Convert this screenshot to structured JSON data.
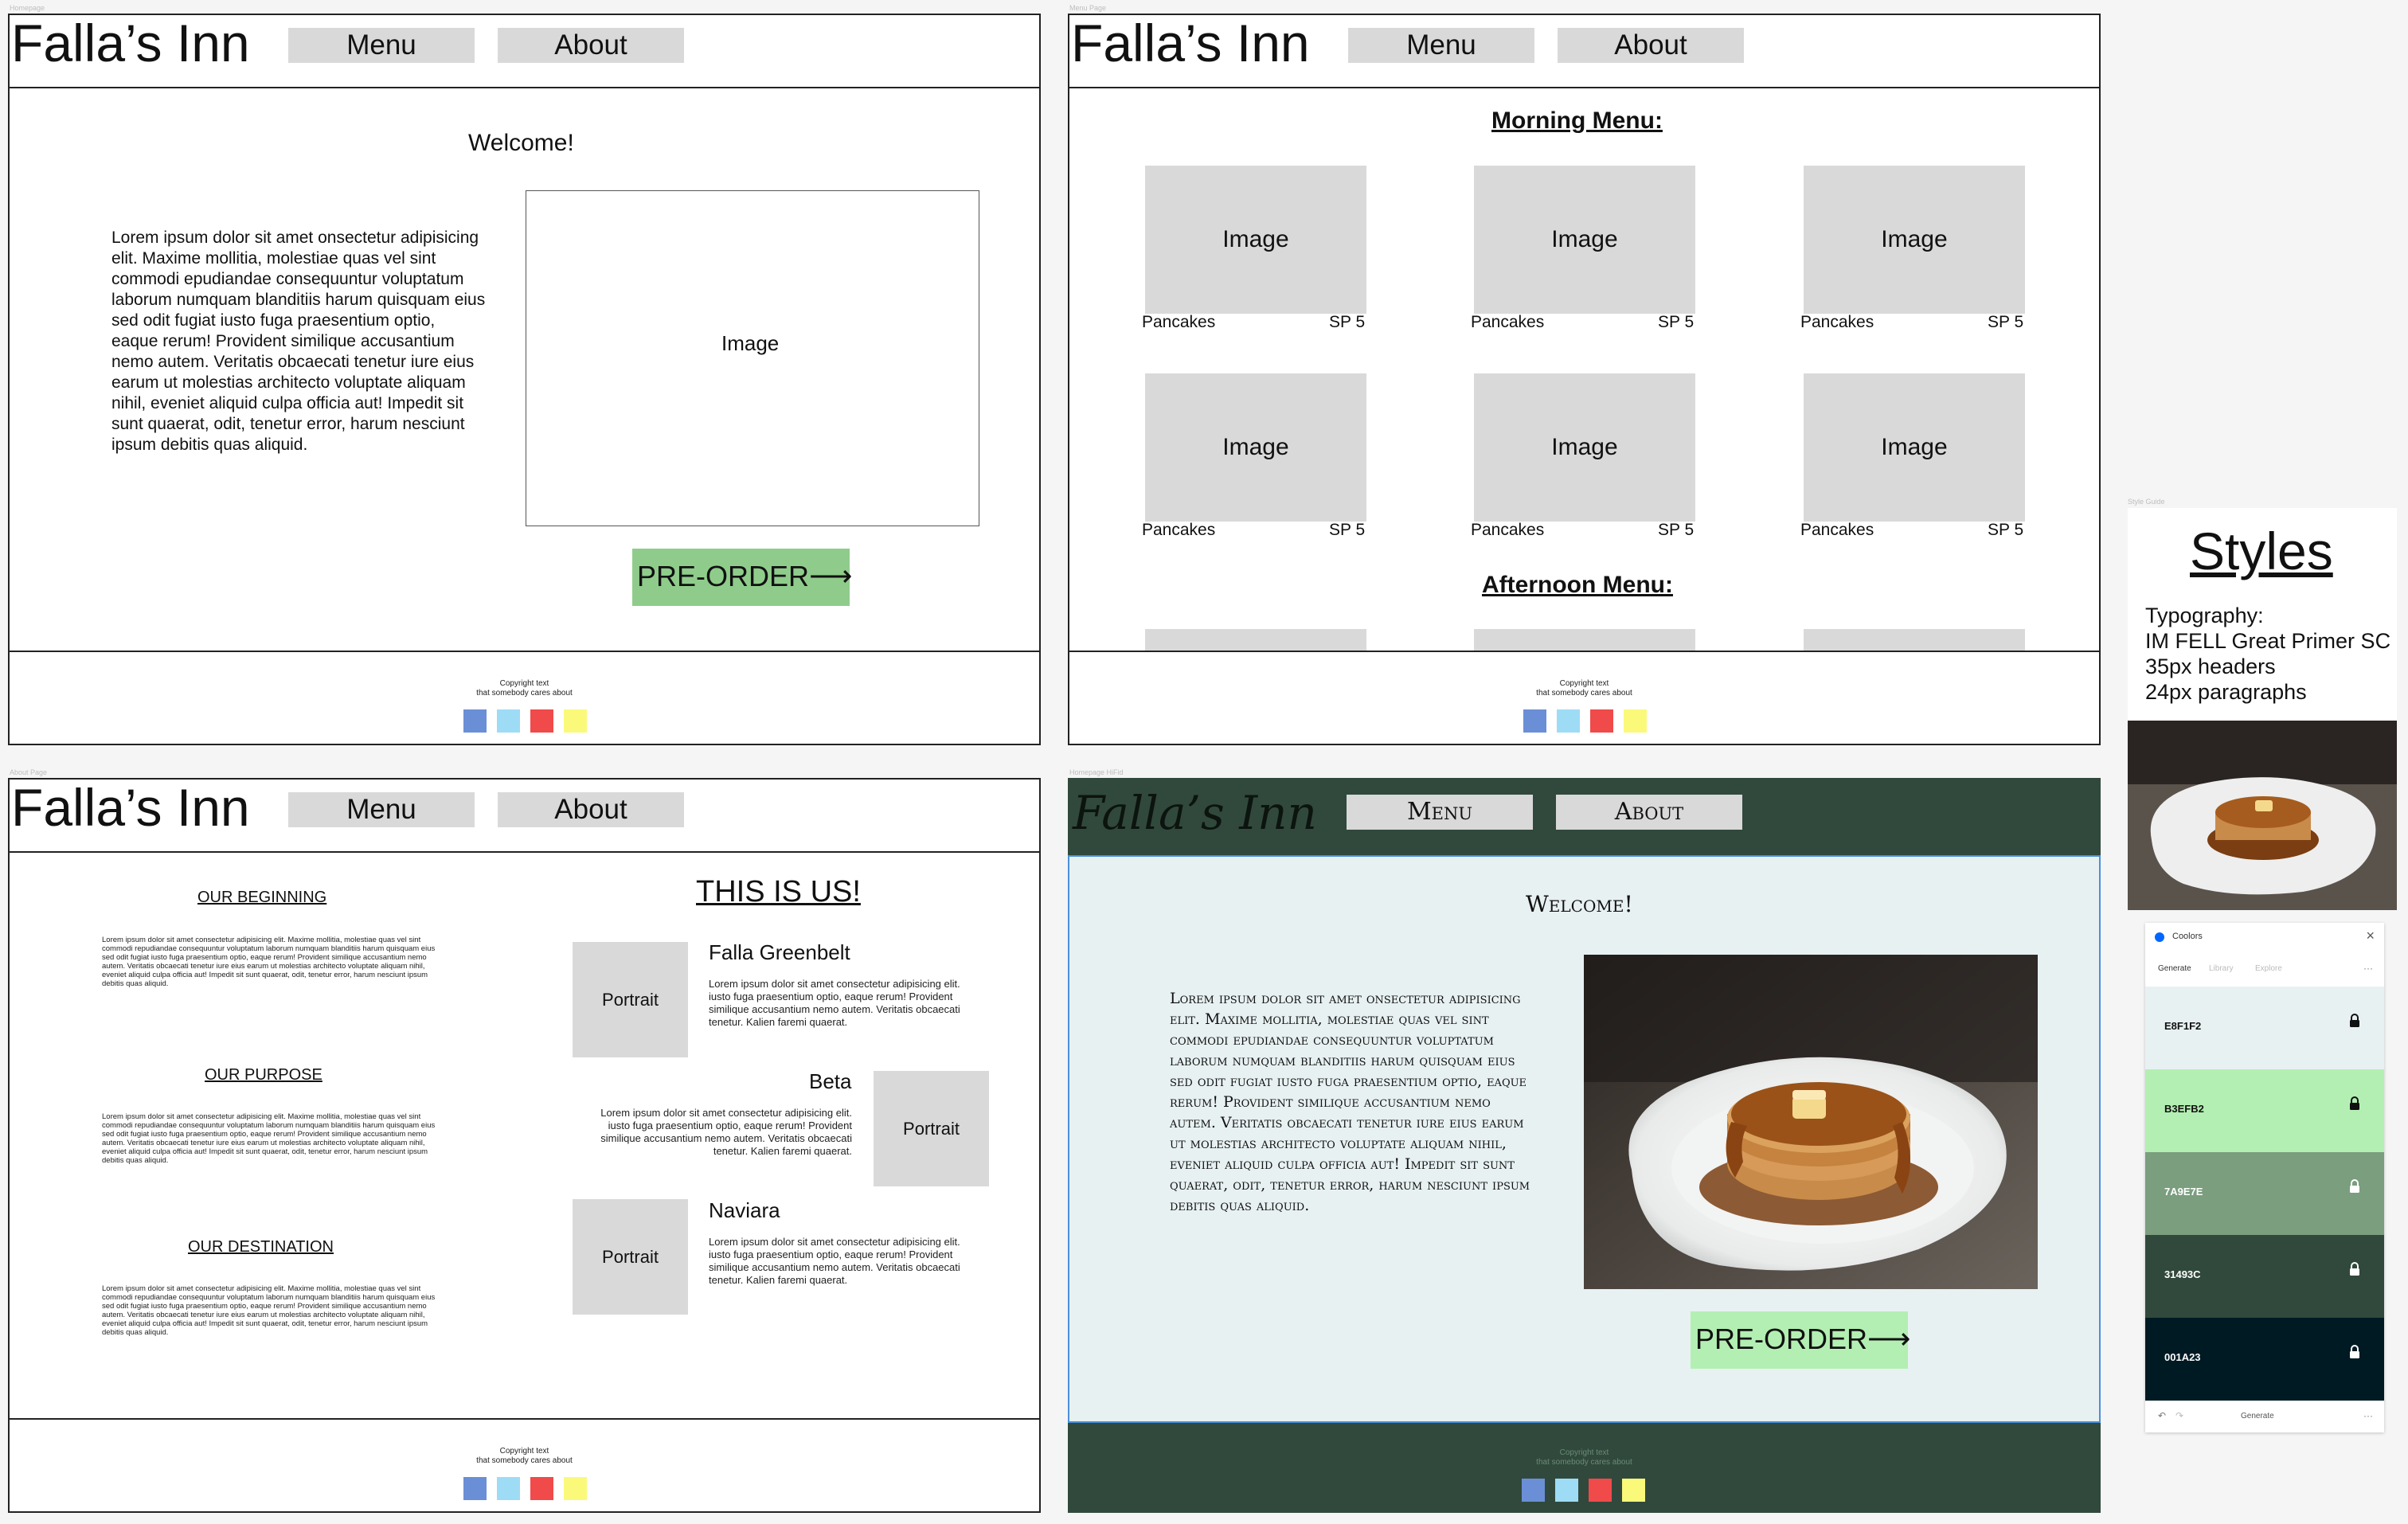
{
  "brand": "Falla’s Inn",
  "nav": {
    "menu": "Menu",
    "about": "About"
  },
  "footer": {
    "copy1": "Copyright text",
    "copy2": "that somebody cares about"
  },
  "swatches": [
    "#6b8fd6",
    "#9edcf6",
    "#f04a4a",
    "#fbf97a"
  ],
  "lorem_long": "Lorem ipsum dolor sit amet onsectetur adipisicing elit. Maxime mollitia, molestiae quas vel sint commodi epudiandae consequuntur voluptatum laborum numquam blanditiis harum quisquam eius sed odit fugiat iusto fuga praesentium optio, eaque rerum! Provident similique accusantium nemo autem. Veritatis obcaecati tenetur iure eius earum ut molestias architecto voluptate aliquam nihil, eveniet aliquid culpa officia aut! Impedit sit sunt quaerat, odit, tenetur error, harum nesciunt ipsum debitis quas aliquid.",
  "lorem_short": "Lorem ipsum dolor sit amet consectetur adipisicing elit.  iusto fuga praesentium optio, eaque rerum! Provident similique accusantium nemo autem. Veritatis obcaecati tenetur. Kalien faremi quaerat.",
  "lorem_small": "Lorem ipsum dolor sit amet consectetur adipisicing elit. Maxime mollitia, molestiae quas vel sint commodi repudiandae consequuntur voluptatum laborum numquam blanditiis harum quisquam eius sed odit fugiat iusto fuga praesentium optio, eaque rerum! Provident similique accusantium nemo autem. Veritatis obcaecati tenetur iure eius earum ut molestias architecto voluptate aliquam nihil, eveniet aliquid culpa officia aut! Impedit sit sunt quaerat, odit, tenetur error, harum nesciunt ipsum debitis quas aliquid.",
  "homepage": {
    "label": "Homepage",
    "welcome": "Welcome!",
    "image": "Image",
    "preorder": "PRE-ORDER"
  },
  "menu_page": {
    "label": "Menu Page",
    "morning": "Morning Menu:",
    "afternoon": "Afternoon Menu:",
    "image": "Image",
    "item": "Pancakes",
    "price": "SP 5"
  },
  "about_page": {
    "label": "About Page",
    "beginning": "OUR BEGINNING",
    "purpose": "OUR PURPOSE",
    "destination": "OUR DESTINATION",
    "this_is_us": "THIS IS US!",
    "portrait": "Portrait",
    "people": [
      "Falla Greenbelt",
      "Beta",
      "Naviara"
    ]
  },
  "hifi": {
    "label": "Homepage HiFid",
    "menu": "Menu",
    "about": "About",
    "welcome": "Welcome!",
    "preorder": "PRE-ORDER"
  },
  "style_guide": {
    "label": "Style Guide",
    "title": "Styles",
    "typo1": "Typography:",
    "typo2": "IM FELL Great Primer SC",
    "typo3": "35px headers",
    "typo4": "24px paragraphs"
  },
  "coolors": {
    "title": "Coolors",
    "tabs": [
      "Generate",
      "Library",
      "Explore"
    ],
    "more": "···",
    "generate": "Generate",
    "palette": [
      {
        "hex": "E8F1F2",
        "color": "#e8f1f2",
        "text": "#111"
      },
      {
        "hex": "B3EFB2",
        "color": "#b3efb2",
        "text": "#111"
      },
      {
        "hex": "7A9E7E",
        "color": "#7a9e7e",
        "text": "#fff"
      },
      {
        "hex": "31493C",
        "color": "#31493c",
        "text": "#fff"
      },
      {
        "hex": "001A23",
        "color": "#001a23",
        "text": "#fff"
      }
    ]
  },
  "colors": {
    "preorder_lowfi": "#8fcc8b",
    "hifi_header": "#31493c",
    "hifi_body": "#e8f1f2",
    "hifi_btn": "#b3efb2"
  }
}
